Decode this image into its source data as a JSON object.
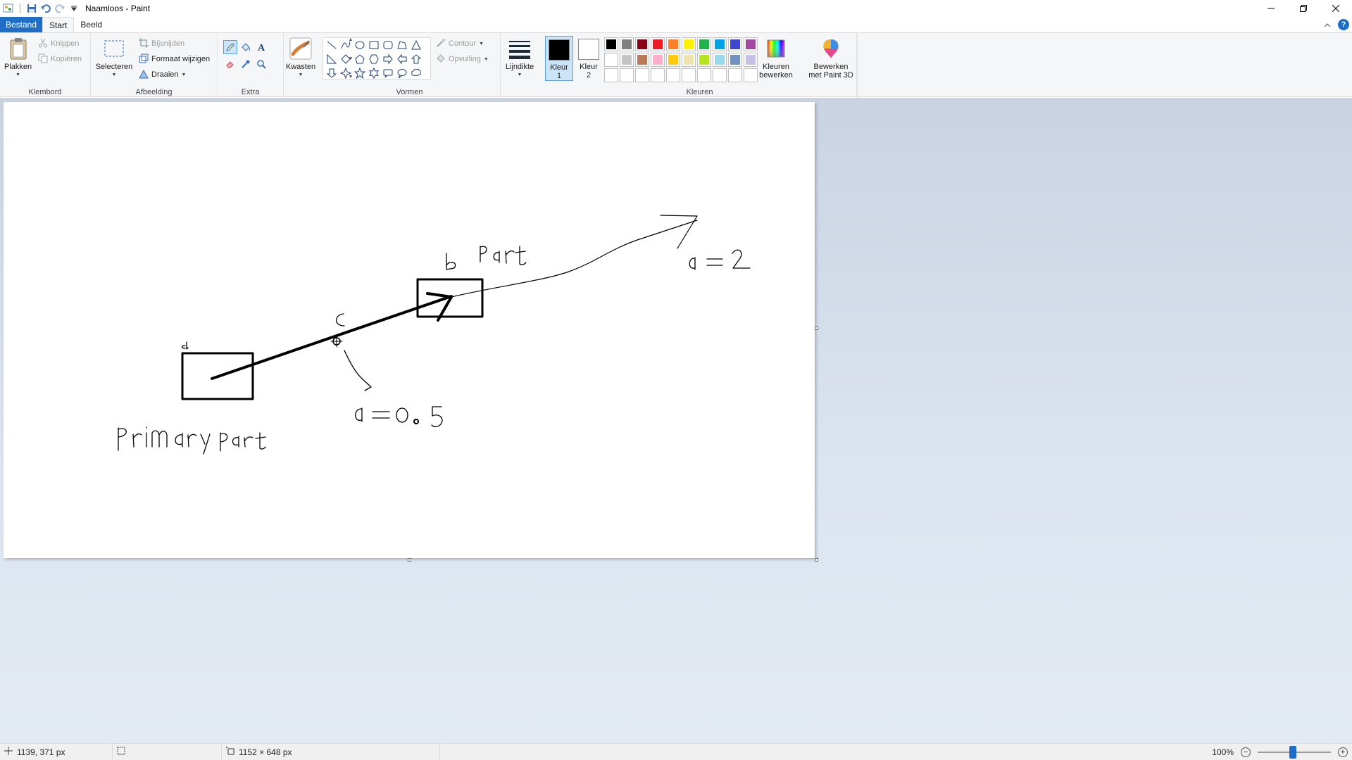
{
  "window": {
    "title": "Naamloos - Paint"
  },
  "tabs": {
    "file": "Bestand",
    "home": "Start",
    "view": "Beeld"
  },
  "clipboard": {
    "paste": "Plakken",
    "cut": "Knippen",
    "copy": "Kopiëren",
    "group": "Klembord"
  },
  "image": {
    "select": "Selecteren",
    "crop": "Bijsnijden",
    "resize": "Formaat wijzigen",
    "rotate": "Draaien",
    "group": "Afbeelding"
  },
  "tools": {
    "group": "Extra",
    "selected": "pencil-icon"
  },
  "brushes": {
    "label": "Kwasten"
  },
  "shapes": {
    "outline": "Contour",
    "fill": "Opvulling",
    "group": "Vormen"
  },
  "size": {
    "label": "Lijndikte"
  },
  "colors": {
    "color1_line1": "Kleur",
    "color1_line2": "1",
    "color2_line1": "Kleur",
    "color2_line2": "2",
    "color1_value": "#000000",
    "color2_value": "#ffffff",
    "edit_line1": "Kleuren",
    "edit_line2": "bewerken",
    "group": "Kleuren",
    "palette": [
      "#000000",
      "#7f7f7f",
      "#880015",
      "#ed1c24",
      "#ff7f27",
      "#fff200",
      "#22b14c",
      "#00a2e8",
      "#3f48cc",
      "#a349a4",
      "#ffffff",
      "#c3c3c3",
      "#b97a57",
      "#ffaec9",
      "#ffc90e",
      "#efe4b0",
      "#b5e61d",
      "#99d9ea",
      "#7092be",
      "#c8bfe7",
      "#ffffff",
      "#ffffff",
      "#ffffff",
      "#ffffff",
      "#ffffff",
      "#ffffff",
      "#ffffff",
      "#ffffff",
      "#ffffff",
      "#ffffff"
    ]
  },
  "paint3d": {
    "line1": "Bewerken",
    "line2": "met Paint 3D"
  },
  "status": {
    "cursor": "1139, 371 px",
    "canvas_size": "1152 × 648 px",
    "zoom": "100%"
  }
}
